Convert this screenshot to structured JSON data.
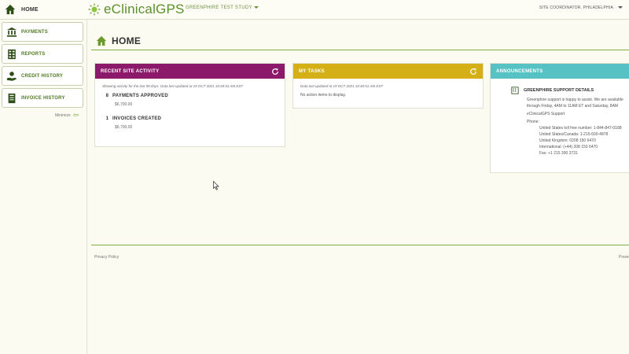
{
  "topbar": {
    "home_label": "HOME",
    "brand_name": "eClinicalGPS",
    "study_name": "GREENPHIRE TEST STUDY",
    "user_role": "SITE COORDINATOR, PHILADELPHIA"
  },
  "sidebar": {
    "items": [
      {
        "label": "PAYMENTS",
        "icon": "bank-icon"
      },
      {
        "label": "REPORTS",
        "icon": "spreadsheet-icon"
      },
      {
        "label": "CREDIT HISTORY",
        "icon": "hand-money-icon"
      },
      {
        "label": "INVOICE HISTORY",
        "icon": "ledger-icon"
      }
    ],
    "minimize_label": "Minimize"
  },
  "page": {
    "title": "HOME"
  },
  "panels": {
    "recent": {
      "title": "RECENT SITE ACTIVITY",
      "color": "#8b1a6b",
      "note": "Showing activity for the last 90 days. Data last updated at 19 OCT 2021 10:40:51 AM EST",
      "stats": [
        {
          "count": "8",
          "label": "PAYMENTS APPROVED",
          "amount": "$6,700.00"
        },
        {
          "count": "1",
          "label": "INVOICES CREATED",
          "amount": "$6,700.00"
        }
      ]
    },
    "tasks": {
      "title": "MY TASKS",
      "color": "#d4b016",
      "note": "Data last updated at 19 OCT 2021 10:40:51 AM EST",
      "empty": "No action items to display."
    },
    "announcements": {
      "title": "ANNOUNCEMENTS",
      "color": "#56c2c4",
      "heading": "GREENPHIRE SUPPORT DETAILS",
      "intro1": "Greenphire support is happy to assist. We are available",
      "intro2": "through Friday, 4AM to 11AM ET and Saturday, 8AM",
      "support": "eClinicalGPS Support",
      "phone_label": "Phone:",
      "phones": [
        "United States toll free number: 1-844-847-0188",
        "United States/Canada: 1-215-600-4878",
        "United Kingdom: 0208 150 6470",
        "International: (+44) 208 150 6470",
        "Fax: +1 215 390 3731"
      ]
    }
  },
  "footer": {
    "privacy": "Privacy Policy",
    "powered": "Powered"
  }
}
